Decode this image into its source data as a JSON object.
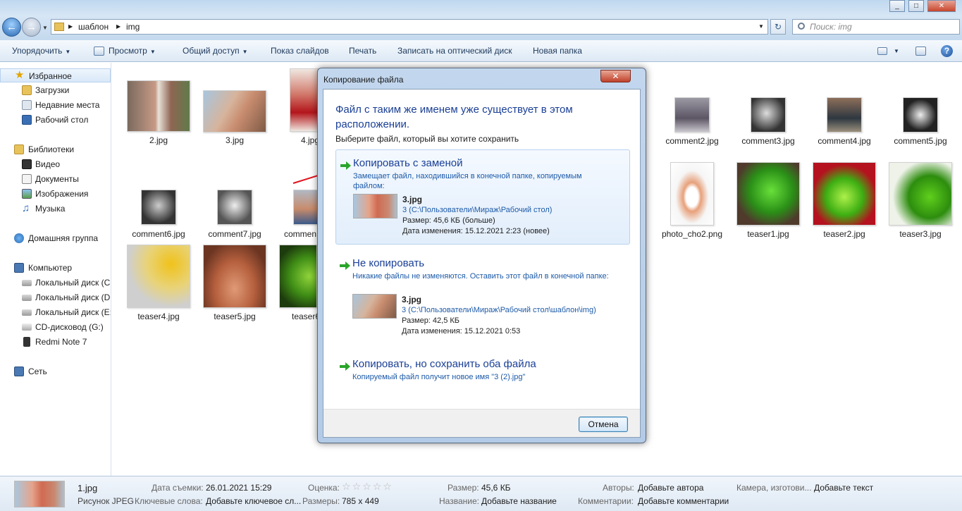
{
  "titlebar": {
    "minimize": "_",
    "maximize": "□",
    "close": "✕"
  },
  "address": {
    "path1": "шаблон",
    "path2": "img",
    "search_placeholder": "Поиск: img"
  },
  "toolbar": {
    "organize": "Упорядочить",
    "view": "Просмотр",
    "share": "Общий доступ",
    "slideshow": "Показ слайдов",
    "print": "Печать",
    "burn": "Записать на оптический диск",
    "new_folder": "Новая папка",
    "help": "?"
  },
  "sidebar": {
    "items": [
      {
        "label": "Избранное",
        "icon": "star-icon",
        "level": 0
      },
      {
        "label": "Загрузки",
        "icon": "downloads-icon",
        "level": 1
      },
      {
        "label": "Недавние места",
        "icon": "recent-places-icon",
        "level": 1
      },
      {
        "label": "Рабочий стол",
        "icon": "desktop-icon",
        "level": 1
      },
      {
        "label": "Библиотеки",
        "icon": "libraries-icon",
        "level": 0
      },
      {
        "label": "Видео",
        "icon": "video-icon",
        "level": 1
      },
      {
        "label": "Документы",
        "icon": "documents-icon",
        "level": 1
      },
      {
        "label": "Изображения",
        "icon": "pictures-icon",
        "level": 1
      },
      {
        "label": "Музыка",
        "icon": "music-icon",
        "level": 1
      },
      {
        "label": "Домашняя группа",
        "icon": "homegroup-icon",
        "level": 0
      },
      {
        "label": "Компьютер",
        "icon": "computer-icon",
        "level": 0
      },
      {
        "label": "Локальный диск (C",
        "icon": "drive-c-icon",
        "level": 1
      },
      {
        "label": "Локальный диск (D",
        "icon": "drive-icon",
        "level": 1
      },
      {
        "label": "Локальный диск (E:",
        "icon": "drive-icon",
        "level": 1
      },
      {
        "label": "CD-дисковод (G:)",
        "icon": "cd-drive-icon",
        "level": 1
      },
      {
        "label": "Redmi Note 7",
        "icon": "phone-icon",
        "level": 1
      },
      {
        "label": "Сеть",
        "icon": "network-icon",
        "level": 0
      }
    ]
  },
  "files": [
    {
      "name": "2.jpg"
    },
    {
      "name": "3.jpg"
    },
    {
      "name": "4.jpg"
    },
    {
      "name": "comment2.jpg"
    },
    {
      "name": "comment3.jpg"
    },
    {
      "name": "comment4.jpg"
    },
    {
      "name": "comment5.jpg"
    },
    {
      "name": "comment6.jpg"
    },
    {
      "name": "comment7.jpg"
    },
    {
      "name": "commen"
    },
    {
      "name": "photo_cho2.png"
    },
    {
      "name": "teaser1.jpg"
    },
    {
      "name": "teaser2.jpg"
    },
    {
      "name": "teaser3.jpg"
    },
    {
      "name": "teaser4.jpg"
    },
    {
      "name": "teaser5.jpg"
    },
    {
      "name": "teaser6"
    }
  ],
  "dialog": {
    "title": "Копирование файла",
    "close": "✕",
    "heading": "Файл с таким же именем уже существует в этом расположении.",
    "subtitle": "Выберите файл, который вы хотите сохранить",
    "option1": {
      "title": "Копировать с заменой",
      "desc": "Замещает файл, находившийся в конечной папке, копируемым файлом:",
      "file": "3.jpg",
      "path": "3 (C:\\Пользователи\\Мираж\\Рабочий стол)",
      "size": "Размер: 45,6 КБ (больше)",
      "date": "Дата изменения: 15.12.2021 2:23 (новее)"
    },
    "option2": {
      "title": "Не копировать",
      "desc": "Никакие файлы не изменяются. Оставить этот файл в конечной папке:",
      "file": "3.jpg",
      "path": "3 (C:\\Пользователи\\Мираж\\Рабочий стол\\шаблон\\img)",
      "size": "Размер: 42,5 КБ",
      "date": "Дата изменения: 15.12.2021 0:53"
    },
    "option3": {
      "title": "Копировать, но сохранить оба файла",
      "desc": "Копируемый файл получит новое имя \"3 (2).jpg\""
    },
    "cancel": "Отмена"
  },
  "details": {
    "filename": "1.jpg",
    "filetype": "Рисунок JPEG",
    "date_taken_label": "Дата съемки:",
    "date_taken": "26.01.2021 15:29",
    "keywords_label": "Ключевые слова:",
    "keywords": "Добавьте ключевое сл...",
    "rating_label": "Оценка:",
    "dimensions_label": "Размеры:",
    "dimensions": "785 x 449",
    "size_label": "Размер:",
    "size": "45,6 КБ",
    "title_label": "Название:",
    "title": "Добавьте название",
    "authors_label": "Авторы:",
    "authors": "Добавьте автора",
    "comments_label": "Комментарии:",
    "comments": "Добавьте комментарии",
    "camera_label": "Камера, изготови...",
    "camera": "Добавьте текст",
    "rating_stars": 0
  },
  "colors": {
    "accent": "#1a3f96",
    "link": "#1d5aa8",
    "arrow": "#e0141e"
  }
}
